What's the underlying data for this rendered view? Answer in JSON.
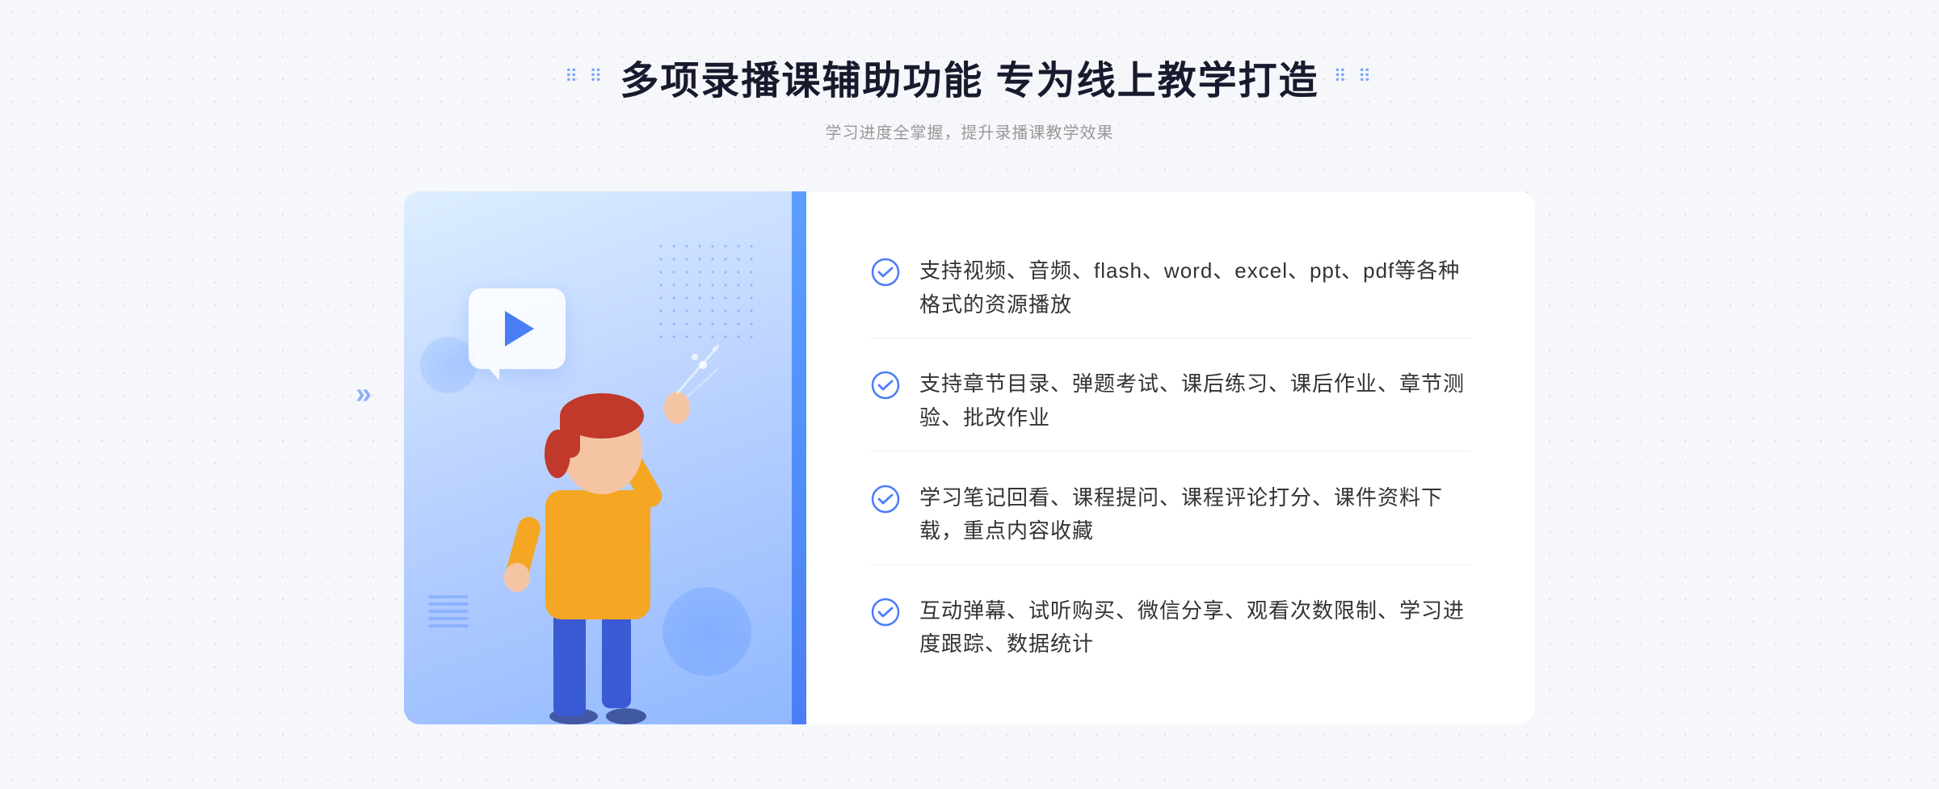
{
  "header": {
    "title": "多项录播课辅助功能 专为线上教学打造",
    "subtitle": "学习进度全掌握，提升录播课教学效果",
    "title_dots_left": "⠿ ⠿",
    "title_dots_right": "⠿ ⠿"
  },
  "features": [
    {
      "id": 1,
      "text": "支持视频、音频、flash、word、excel、ppt、pdf等各种格式的资源播放"
    },
    {
      "id": 2,
      "text": "支持章节目录、弹题考试、课后练习、课后作业、章节测验、批改作业"
    },
    {
      "id": 3,
      "text": "学习笔记回看、课程提问、课程评论打分、课件资料下载，重点内容收藏"
    },
    {
      "id": 4,
      "text": "互动弹幕、试听购买、微信分享、观看次数限制、学习进度跟踪、数据统计"
    }
  ],
  "colors": {
    "primary": "#4a7ef5",
    "title": "#1a1a2e",
    "subtitle": "#999999",
    "text": "#333333",
    "check": "#4a7ef5",
    "panel_bg": "#ffffff"
  }
}
